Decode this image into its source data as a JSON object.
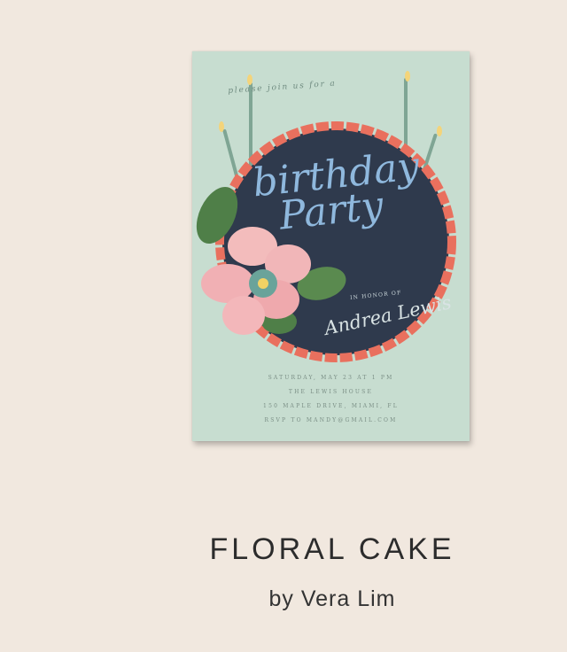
{
  "card": {
    "intro": "please join us for a",
    "title_line1": "birthday",
    "title_line2": "Party",
    "honor": "IN HONOR OF",
    "guest": "Andrea Lewis",
    "date": "SATURDAY, MAY 23 AT 1 PM",
    "venue": "THE LEWIS HOUSE",
    "address": "150 MAPLE DRIVE, MIAMI, FL",
    "rsvp": "RSVP TO MANDY@GMAIL.COM"
  },
  "product": {
    "name": "FLORAL CAKE",
    "byline": "by Vera Lim"
  },
  "colors": {
    "background": "#f1e8df",
    "card": "#c7ddd0",
    "cake": "#2f3a4d",
    "frosting": "#e9705e",
    "title": "#8fb8dd"
  }
}
